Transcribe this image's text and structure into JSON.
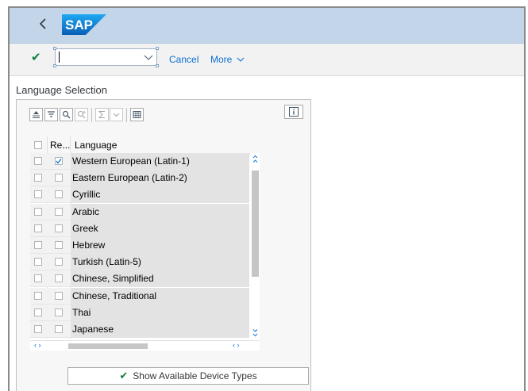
{
  "shell": {
    "logo_text": "SAP",
    "back_icon": "chevron-left-icon"
  },
  "toolbar": {
    "confirm_icon": "check-icon",
    "command_value": "",
    "cancel_label": "Cancel",
    "more_label": "More"
  },
  "section": {
    "title": "Language Selection"
  },
  "grid": {
    "header": {
      "col_re": "Re...",
      "col_language": "Language"
    },
    "rows": [
      {
        "language": "Western European (Latin-1)",
        "checked": true
      },
      {
        "language": "Eastern European (Latin-2)",
        "checked": false
      },
      {
        "language": "Cyrillic",
        "checked": false
      },
      {
        "language": "Arabic",
        "checked": false
      },
      {
        "language": "Greek",
        "checked": false
      },
      {
        "language": "Hebrew",
        "checked": false
      },
      {
        "language": "Turkish (Latin-5)",
        "checked": false
      },
      {
        "language": "Chinese, Simplified",
        "checked": false
      },
      {
        "language": "Chinese, Traditional",
        "checked": false
      },
      {
        "language": "Thai",
        "checked": false
      },
      {
        "language": "Japanese",
        "checked": false
      }
    ]
  },
  "footer": {
    "button_label": "Show Available Device Types"
  },
  "colors": {
    "shell": "#c3d6e9",
    "link": "#0a6ed1",
    "ok": "#107e3e",
    "sap_blue": "#0a6ed1"
  }
}
